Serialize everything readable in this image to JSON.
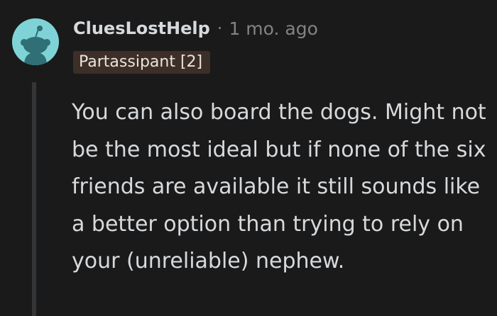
{
  "comment": {
    "username": "CluesLostHelp",
    "separator": "·",
    "timestamp": "1 mo. ago",
    "flair": "Partassipant [2]",
    "body": "You can also board the dogs. Might not be the most ideal but if none of the six friends are available it still sounds like a better option than trying to rely on your (unreliable) nephew."
  },
  "icons": {
    "avatar": "reddit-snoo-avatar-icon"
  },
  "colors": {
    "background": "#1a1a1b",
    "avatar_bg": "#7fd3d6",
    "text_primary": "#d7dadc",
    "text_muted": "#818384",
    "flair_bg": "#3d2f27",
    "thread_line": "#343536"
  }
}
